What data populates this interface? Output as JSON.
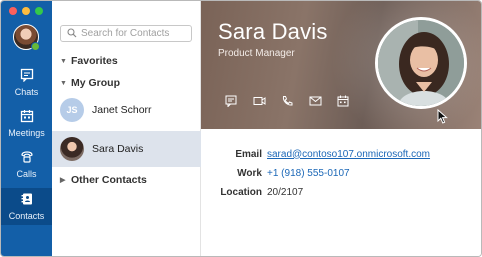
{
  "rail": {
    "items": [
      {
        "label": "Chats",
        "icon": "chat-icon"
      },
      {
        "label": "Meetings",
        "icon": "calendar-icon"
      },
      {
        "label": "Calls",
        "icon": "phone-icon"
      },
      {
        "label": "Contacts",
        "icon": "contacts-book-icon"
      }
    ],
    "active": "Contacts",
    "presence_color": "#67b93a",
    "color": "#135fa8"
  },
  "contacts_panel": {
    "search_placeholder": "Search for Contacts",
    "groups": [
      {
        "label": "Favorites",
        "expanded": true
      },
      {
        "label": "My Group",
        "expanded": true
      },
      {
        "label": "Other Contacts",
        "expanded": false
      }
    ],
    "contacts": [
      {
        "name": "Janet Schorr",
        "initials": "JS"
      },
      {
        "name": "Sara Davis",
        "selected": true
      }
    ]
  },
  "profile": {
    "name": "Sara Davis",
    "title": "Product Manager",
    "actions": [
      "chat-icon",
      "video-icon",
      "phone-icon",
      "mail-icon",
      "calendar-icon"
    ],
    "fields": {
      "email_label": "Email",
      "email_value": "sarad@contoso107.onmicrosoft.com",
      "work_label": "Work",
      "work_value": "+1 (918) 555-0107",
      "location_label": "Location",
      "location_value": "20/2107"
    },
    "link_color": "#1b67b7"
  }
}
